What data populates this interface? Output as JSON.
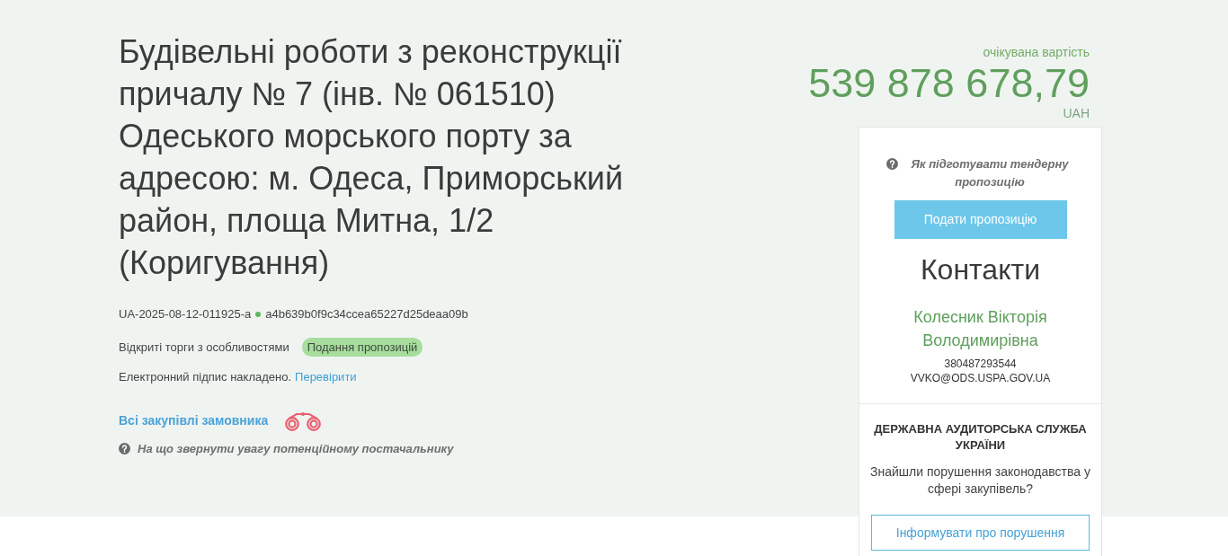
{
  "tender": {
    "title": "Будівельні роботи з реконструкції причалу № 7 (інв. № 061510) Одеського морського порту за адресою: м. Одеса, Приморський район, площа Митна, 1/2 (Коригування)",
    "id": "UA-2025-08-12-011925-a",
    "hash": "a4b639b0f9c34ccea65227d25deaa09b",
    "procedure": "Відкриті торги з особливостями",
    "status": "Подання пропозицій",
    "signature": {
      "text": "Електронний підпис накладено.",
      "link": "Перевірити"
    },
    "buyer_link": "Всі закупівлі замовника",
    "supplier_hint": "На що звернути увагу потенційному постачальнику"
  },
  "value": {
    "label": "очікувана вартість",
    "amount": "539 878 678,79",
    "currency": "UAH"
  },
  "sidebar": {
    "bid_help": "Як підготувати тендерну пропозицію",
    "bid_button": "Подати пропозицію",
    "contacts": {
      "title": "Контакти",
      "name": "Колесник Вікторія Володимирівна",
      "phone": "380487293544",
      "email": "VVKO@ODS.USPA.GOV.UA"
    },
    "audit": {
      "title": "ДЕРЖАВНА АУДИТОРСЬКА СЛУЖБА УКРАЇНИ",
      "text": "Знайшли порушення законодавства у сфері закупівель?",
      "button": "Інформувати про порушення"
    }
  }
}
